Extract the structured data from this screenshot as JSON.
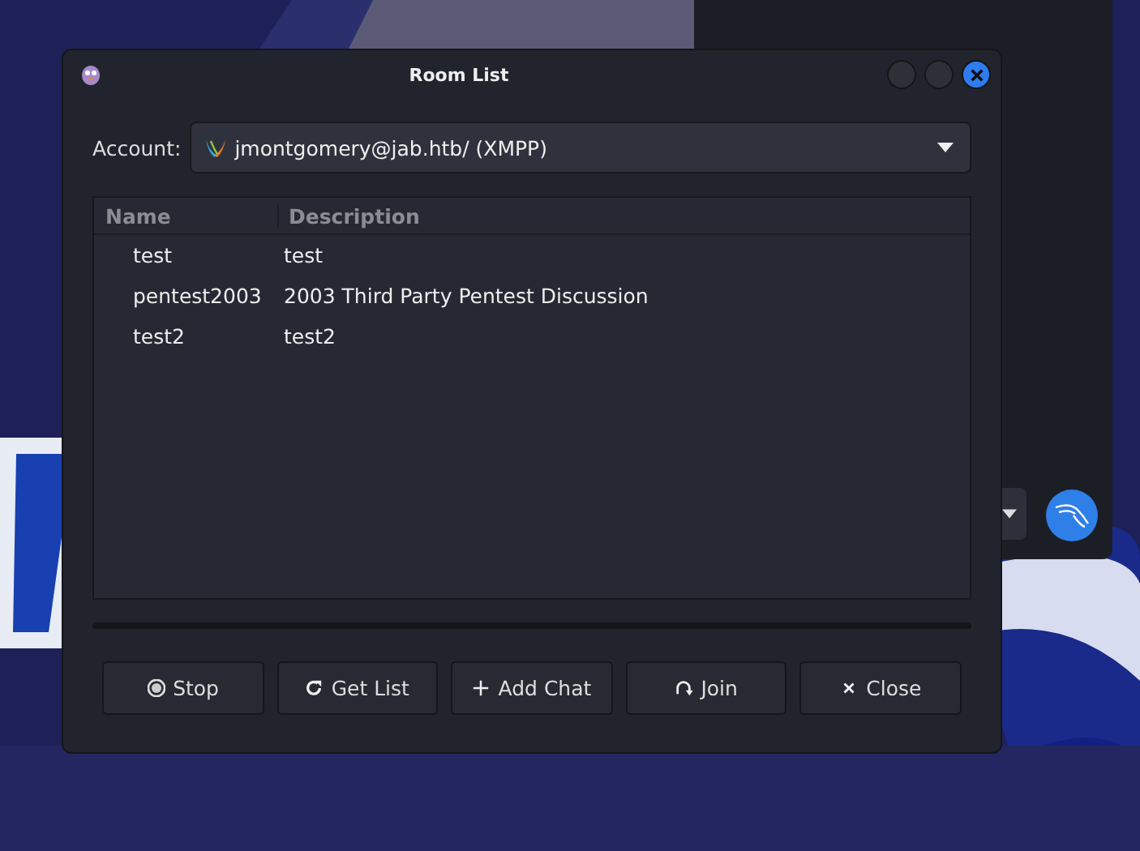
{
  "window": {
    "title": "Room List"
  },
  "account": {
    "label": "Account:",
    "value": "jmontgomery@jab.htb/ (XMPP)"
  },
  "table": {
    "columns": [
      "Name",
      "Description"
    ],
    "rows": [
      {
        "name": "test",
        "description": "test"
      },
      {
        "name": "pentest2003",
        "description": "2003 Third Party Pentest Discussion"
      },
      {
        "name": "test2",
        "description": "test2"
      }
    ]
  },
  "progress": {
    "level": 0
  },
  "buttons": [
    {
      "label": "Stop",
      "kind": "stop"
    },
    {
      "label": "Get List",
      "kind": "refresh"
    },
    {
      "label": "Add Chat",
      "kind": "add"
    },
    {
      "label": "Join",
      "kind": "join"
    },
    {
      "label": "Close",
      "kind": "close"
    }
  ]
}
